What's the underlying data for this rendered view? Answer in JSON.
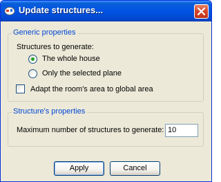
{
  "window": {
    "title": "Update structures..."
  },
  "generic_properties": {
    "caption": "Generic properties",
    "structures_label": "Structures to generate:",
    "options": [
      {
        "label": "The whole house",
        "selected": true
      },
      {
        "label": "Only the selected plane",
        "selected": false
      }
    ],
    "adapt_checkbox": {
      "label": "Adapt the room's area to global area",
      "checked": false
    }
  },
  "structure_properties": {
    "caption": "Structure's properties",
    "max_label": "Maximum number of structures to generate:",
    "max_value": "10"
  },
  "buttons": {
    "apply": "Apply",
    "cancel": "Cancel"
  },
  "colors": {
    "titlebar": "#0054e3",
    "dialog_bg": "#ece9d8",
    "group_caption": "#0046d5",
    "radio_selected": "#21a121",
    "close_button": "#d5472a"
  }
}
